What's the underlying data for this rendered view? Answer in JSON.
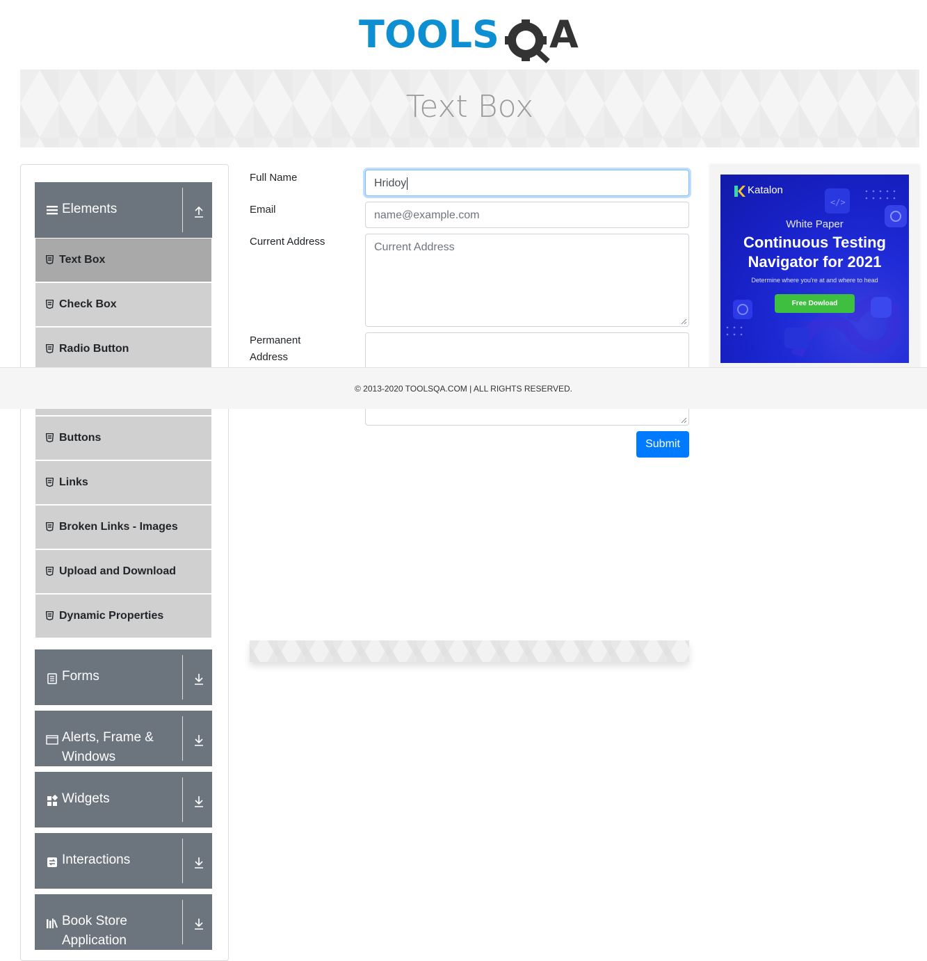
{
  "header": {
    "logo": {
      "text_left": "TOOLS",
      "text_right": "A",
      "colors": {
        "tools": "#0d8fd1",
        "qa": "#333333"
      }
    }
  },
  "banner": {
    "title": "Text Box"
  },
  "sidebar": {
    "groups": [
      {
        "title": "Elements",
        "icon": "hamburger-icon",
        "expanded": true,
        "arrow": "arrow-up-icon",
        "items": [
          {
            "label": "Text Box",
            "active": true
          },
          {
            "label": "Check Box"
          },
          {
            "label": "Radio Button"
          },
          {
            "label": "Buttons"
          },
          {
            "label": "Links"
          },
          {
            "label": "Broken Links - Images"
          },
          {
            "label": "Upload and Download"
          },
          {
            "label": "Dynamic Properties"
          }
        ]
      },
      {
        "title": "Forms",
        "icon": "form-icon",
        "arrow": "arrow-down-icon"
      },
      {
        "title_line1": "Alerts, Frame &",
        "title_line2": "Windows",
        "icon": "window-icon",
        "arrow": "arrow-down-icon"
      },
      {
        "title": "Widgets",
        "icon": "widgets-icon",
        "arrow": "arrow-down-icon"
      },
      {
        "title": "Interactions",
        "icon": "interactions-icon",
        "arrow": "arrow-down-icon"
      },
      {
        "title_line1": "Book Store",
        "title_line2": "Application",
        "icon": "books-icon",
        "arrow": "arrow-down-icon"
      }
    ]
  },
  "form": {
    "full_name": {
      "label": "Full Name",
      "value": "Hridoy",
      "focused": true
    },
    "email": {
      "label": "Email",
      "placeholder": "name@example.com"
    },
    "current_address": {
      "label": "Current Address",
      "placeholder": "Current Address"
    },
    "permanent_address": {
      "label_line1": "Permanent",
      "label_line2": "Address"
    },
    "submit_label": "Submit"
  },
  "ad": {
    "brand": "Katalon",
    "eyebrow": "White Paper",
    "headline_line1": "Continuous Testing",
    "headline_line2": "Navigator for 2021",
    "subtext": "Determine where you're at and where to head",
    "cta": "Free Dowload"
  },
  "footer": {
    "text": "© 2013-2020 TOOLSQA.COM | ALL RIGHTS RESERVED."
  },
  "colors": {
    "accent": "#007bff",
    "sidebar_header": "#6c757d",
    "menu_item": "#d0d0d0",
    "menu_item_active": "#a9a9a9"
  }
}
